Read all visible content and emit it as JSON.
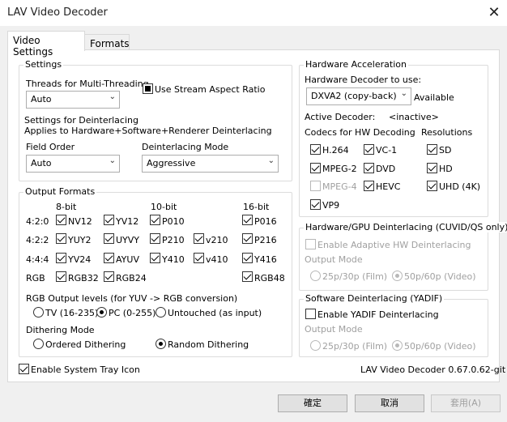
{
  "window": {
    "title": "LAV Video Decoder",
    "close_glyph": "✕"
  },
  "tabs": [
    {
      "label": "Video Settings"
    },
    {
      "label": "Formats"
    }
  ],
  "settings": {
    "legend": "Settings",
    "threads_label": "Threads for Multi-Threading",
    "threads_value": "Auto",
    "stream_aspect_label": "Use Stream Aspect Ratio",
    "deint_title": "Settings for Deinterlacing",
    "deint_sub": "Applies to Hardware+Software+Renderer Deinterlacing",
    "field_order_label": "Field Order",
    "field_order_value": "Auto",
    "deint_mode_label": "Deinterlacing Mode",
    "deint_mode_value": "Aggressive"
  },
  "output": {
    "legend": "Output Formats",
    "col_8bit": "8-bit",
    "col_10bit": "10-bit",
    "col_16bit": "16-bit",
    "row_420": "4:2:0",
    "row_422": "4:2:2",
    "row_444": "4:4:4",
    "row_rgb": "RGB",
    "fmt": {
      "nv12": "NV12",
      "yv12": "YV12",
      "p010": "P010",
      "p016": "P016",
      "yuy2": "YUY2",
      "uyvy": "UYVY",
      "p210": "P210",
      "v210": "v210",
      "p216": "P216",
      "yv24": "YV24",
      "ayuv": "AYUV",
      "y410": "Y410",
      "v410": "v410",
      "y416": "Y416",
      "rgb32": "RGB32",
      "rgb24": "RGB24",
      "rgb48": "RGB48"
    },
    "levels_label": "RGB Output levels (for YUV -> RGB conversion)",
    "tv": "TV (16-235)",
    "pc": "PC (0-255)",
    "untouched": "Untouched (as input)",
    "dither_label": "Dithering Mode",
    "ordered": "Ordered Dithering",
    "random": "Random Dithering"
  },
  "tray_label": "Enable System Tray Icon",
  "hwaccel": {
    "legend": "Hardware Acceleration",
    "decoder_label": "Hardware Decoder to use:",
    "decoder_value": "DXVA2 (copy-back)",
    "available": "Available",
    "active_label": "Active Decoder:",
    "active_value": "<inactive>",
    "codecs_label": "Codecs for HW Decoding",
    "res_label": "Resolutions",
    "h264": "H.264",
    "vc1": "VC-1",
    "sd": "SD",
    "mpeg2": "MPEG-2",
    "dvd": "DVD",
    "hd": "HD",
    "mpeg4": "MPEG-4",
    "hevc": "HEVC",
    "uhd": "UHD (4K)",
    "vp9": "VP9"
  },
  "hwdeint": {
    "legend": "Hardware/GPU Deinterlacing (CUVID/QS only)",
    "adaptive": "Enable Adaptive HW Deinterlacing",
    "output_mode": "Output Mode",
    "film": "25p/30p (Film)",
    "video": "50p/60p (Video)"
  },
  "swdeint": {
    "legend": "Software Deinterlacing (YADIF)",
    "yadif": "Enable YADIF Deinterlacing",
    "output_mode": "Output Mode",
    "film": "25p/30p (Film)",
    "video": "50p/60p (Video)"
  },
  "version": "LAV Video Decoder 0.67.0.62-git",
  "buttons": {
    "ok": "確定",
    "cancel": "取消",
    "apply": "套用(A)"
  }
}
